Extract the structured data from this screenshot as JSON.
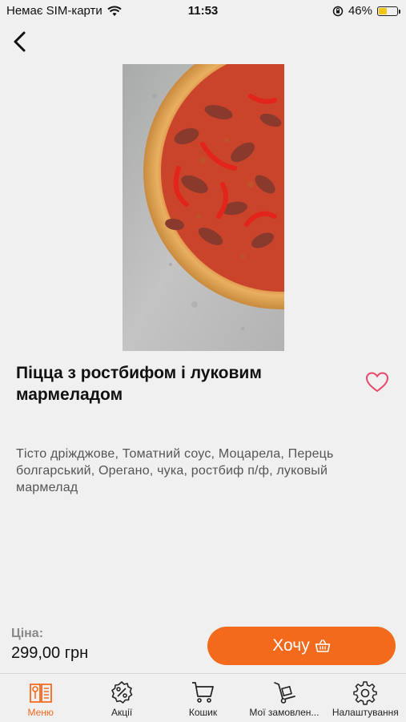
{
  "status_bar": {
    "carrier": "Немає SIM-карти",
    "time": "11:53",
    "battery": "46%",
    "battery_level": 0.46
  },
  "product": {
    "title": "Піцца з ростбифом і луковим мармеладом",
    "description": "Тісто дріжджове, Томатний соус, Моцарела, Перець болгарський, Орегано, чука, ростбиф п/ф, луковый мармелад"
  },
  "price": {
    "label": "Ціна:",
    "value": "299,00 грн"
  },
  "action": {
    "want_label": "Хочу"
  },
  "colors": {
    "accent": "#f36a1d",
    "favorite": "#e8486a",
    "background": "#f0f0f0"
  },
  "tabs": [
    {
      "label": "Меню",
      "icon": "menu-book-icon",
      "active": true
    },
    {
      "label": "Акції",
      "icon": "discount-icon",
      "active": false
    },
    {
      "label": "Кошик",
      "icon": "cart-icon",
      "active": false
    },
    {
      "label": "Мої замовлен...",
      "icon": "hand-truck-icon",
      "active": false
    },
    {
      "label": "Налаштування",
      "icon": "gear-icon",
      "active": false
    }
  ]
}
